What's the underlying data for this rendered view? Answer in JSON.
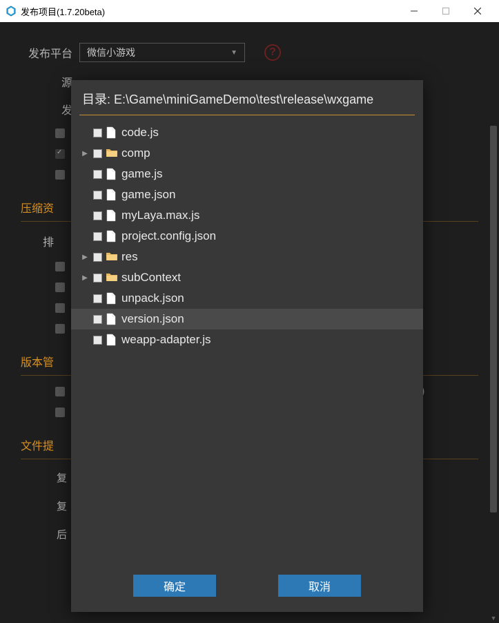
{
  "window": {
    "title": "发布项目(1.7.20beta)"
  },
  "form": {
    "platformLabel": "发布平台",
    "platformValue": "微信小游戏",
    "sourceLabel": "源",
    "publishLabel": "发",
    "compressSection": "压缩资",
    "excludeLabel": "排",
    "versionSection": "版本管",
    "fileSection": "文件提",
    "copyLabel1": "复",
    "copyLabel2": "复",
    "runLabel": "后",
    "parenText": ")"
  },
  "modal": {
    "title": "目录: E:\\Game\\miniGameDemo\\test\\release\\wxgame",
    "okLabel": "确定",
    "cancelLabel": "取消",
    "files": [
      {
        "name": "code.js",
        "type": "file",
        "expandable": false,
        "selected": false
      },
      {
        "name": "comp",
        "type": "folder",
        "expandable": true,
        "selected": false
      },
      {
        "name": "game.js",
        "type": "file",
        "expandable": false,
        "selected": false
      },
      {
        "name": "game.json",
        "type": "file",
        "expandable": false,
        "selected": false
      },
      {
        "name": "myLaya.max.js",
        "type": "file",
        "expandable": false,
        "selected": false
      },
      {
        "name": "project.config.json",
        "type": "file",
        "expandable": false,
        "selected": false
      },
      {
        "name": "res",
        "type": "folder",
        "expandable": true,
        "selected": false
      },
      {
        "name": "subContext",
        "type": "folder",
        "expandable": true,
        "selected": false
      },
      {
        "name": "unpack.json",
        "type": "file",
        "expandable": false,
        "selected": false
      },
      {
        "name": "version.json",
        "type": "file",
        "expandable": false,
        "selected": true
      },
      {
        "name": "weapp-adapter.js",
        "type": "file",
        "expandable": false,
        "selected": false
      }
    ]
  }
}
